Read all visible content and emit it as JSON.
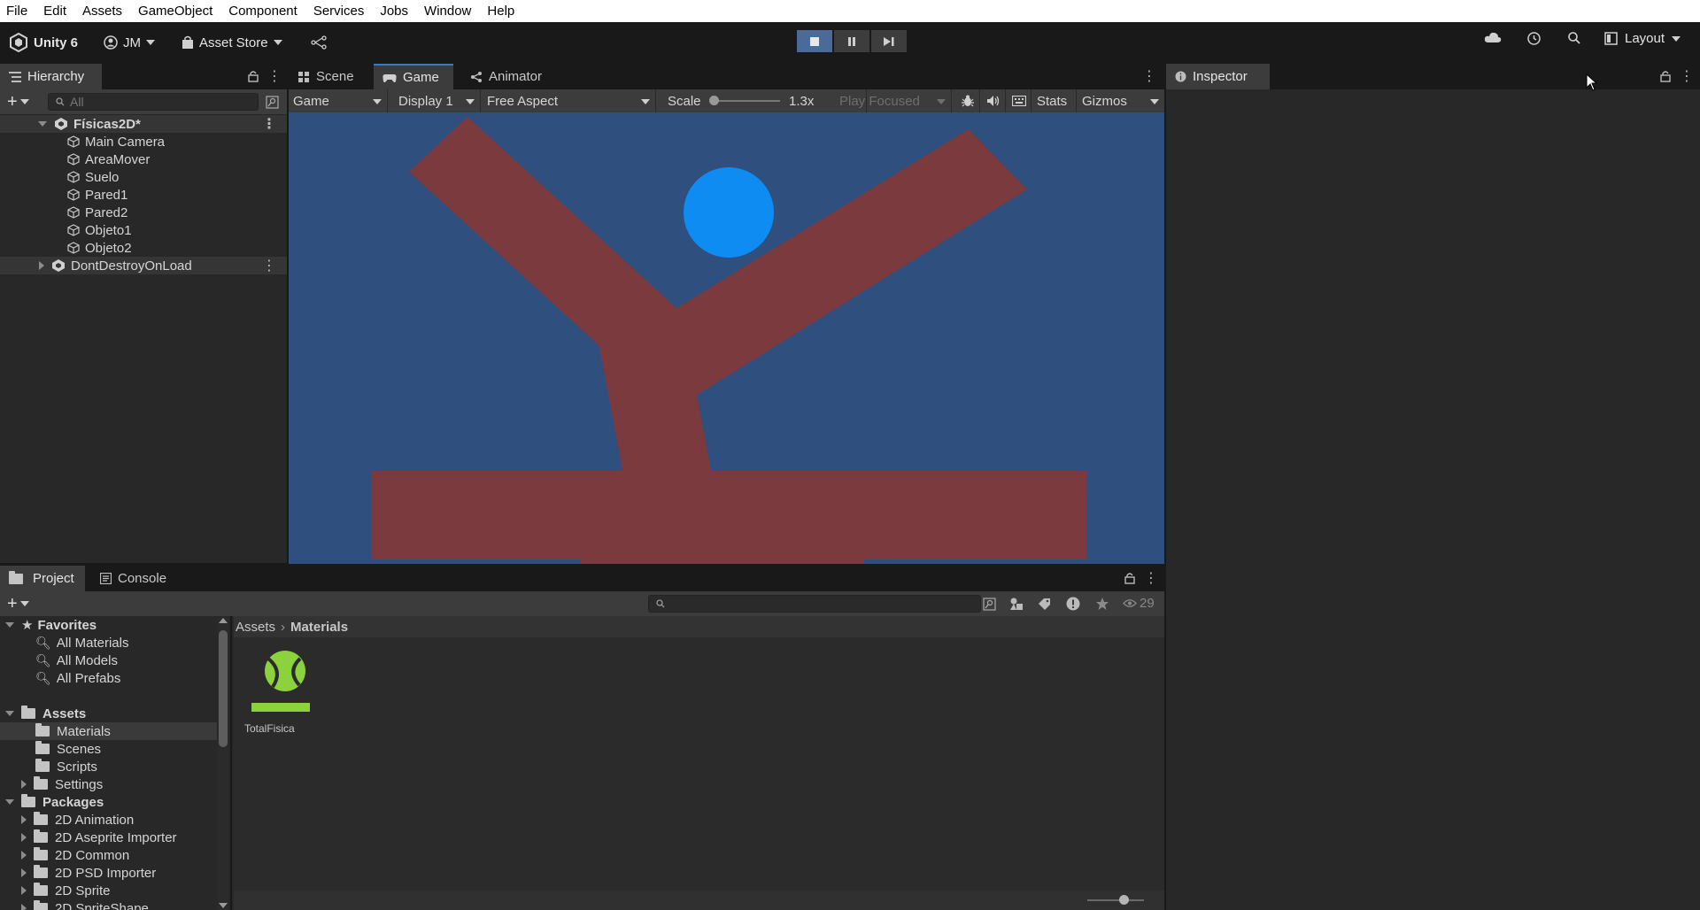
{
  "menu": [
    "File",
    "Edit",
    "Assets",
    "GameObject",
    "Component",
    "Services",
    "Jobs",
    "Window",
    "Help"
  ],
  "toolbar": {
    "app_name": "Unity 6",
    "account": "JM",
    "asset_store": "Asset Store",
    "layout": "Layout"
  },
  "hierarchy": {
    "tab": "Hierarchy",
    "search_placeholder": "All",
    "scene_name": "Físicas2D*",
    "objects": [
      "Main Camera",
      "AreaMover",
      "Suelo",
      "Pared1",
      "Pared2",
      "Objeto1",
      "Objeto2"
    ],
    "dont_destroy": "DontDestroyOnLoad"
  },
  "center_tabs": {
    "scene": "Scene",
    "game": "Game",
    "animator": "Animator"
  },
  "game_toolbar": {
    "view": "Game",
    "display": "Display 1",
    "aspect": "Free Aspect",
    "scale_label": "Scale",
    "scale_value": "1.3x",
    "play_mode": "Play Focused",
    "stats": "Stats",
    "gizmos": "Gizmos"
  },
  "inspector": {
    "tab": "Inspector"
  },
  "project": {
    "tab_project": "Project",
    "tab_console": "Console",
    "hidden_count": "29",
    "favorites": {
      "label": "Favorites",
      "items": [
        "All Materials",
        "All Models",
        "All Prefabs"
      ]
    },
    "assets": {
      "label": "Assets",
      "items": [
        "Materials",
        "Scenes",
        "Scripts",
        "Settings"
      ]
    },
    "packages": {
      "label": "Packages",
      "items": [
        "2D Animation",
        "2D Aseprite Importer",
        "2D Common",
        "2D PSD Importer",
        "2D Sprite",
        "2D SpriteShape"
      ]
    },
    "breadcrumb": [
      "Assets",
      "Materials"
    ],
    "asset_item": "TotalFisica"
  },
  "colors": {
    "game_bg": "#2f4f7f",
    "shape_red": "#7a3a3e",
    "ball_blue": "#0f8cf2",
    "material_green": "#8bd23c"
  }
}
